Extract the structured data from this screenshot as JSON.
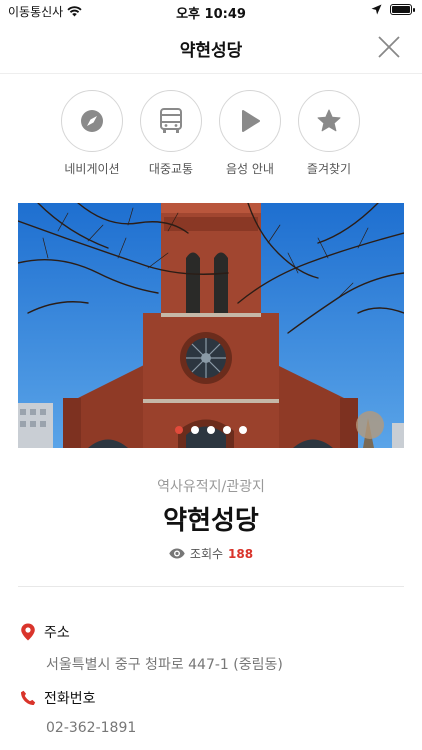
{
  "status_bar": {
    "carrier": "이동통신사",
    "time": "오후 10:49"
  },
  "header": {
    "title": "약현성당"
  },
  "actions": [
    {
      "label": "네비게이션",
      "icon": "compass-icon"
    },
    {
      "label": "대중교통",
      "icon": "bus-icon"
    },
    {
      "label": "음성 안내",
      "icon": "play-icon"
    },
    {
      "label": "즐겨찾기",
      "icon": "star-icon"
    }
  ],
  "gallery": {
    "total": 5,
    "active_index": 0
  },
  "place": {
    "category": "역사유적지/관광지",
    "name": "약현성당",
    "views_label": "조회수",
    "views_count": "188"
  },
  "details": {
    "address_label": "주소",
    "address": "서울특별시 중구 청파로 447-1 (중림동)",
    "phone_label": "전화번호",
    "phone": "02-362-1891"
  },
  "colors": {
    "accent": "#d9342b",
    "icon_gray": "#8a8a8a",
    "sky": "#2f7fd6"
  }
}
